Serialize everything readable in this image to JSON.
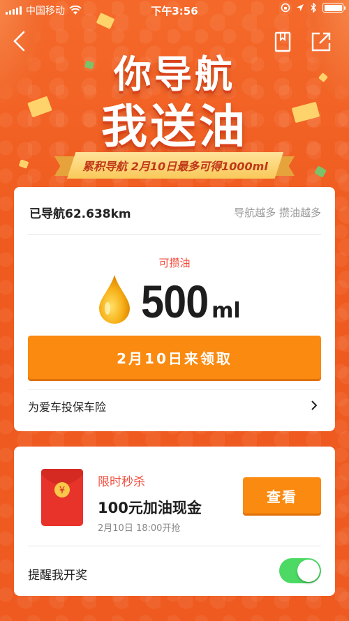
{
  "status_bar": {
    "carrier": "中国移动",
    "time": "下午3:56"
  },
  "header": {
    "icons": [
      "back-icon",
      "bookmark-icon",
      "share-icon"
    ]
  },
  "banner": {
    "title_line1": "你导航",
    "title_line2": "我送油",
    "ribbon_text": "累积导航  2月10日最多可得1000ml"
  },
  "reward_card": {
    "distance": "已导航62.638km",
    "tip": "导航越多 攒油越多",
    "can_get_label": "可攒油",
    "amount": "500",
    "unit": "ml",
    "claim_button": "2月10日来领取",
    "insurance_link": "为爱车投保车险"
  },
  "flash_card": {
    "flash_label": "限时秒杀",
    "cash_title": "100元加油现金",
    "time_text": "2月10日 18:00开抢",
    "view_button": "查看",
    "remind_label": "提醒我开奖",
    "remind_enabled": true
  },
  "colors": {
    "background": "#f15f23",
    "accent_orange": "#fa8a10",
    "red_text": "#f14b3a",
    "toggle_on": "#4cd964"
  }
}
